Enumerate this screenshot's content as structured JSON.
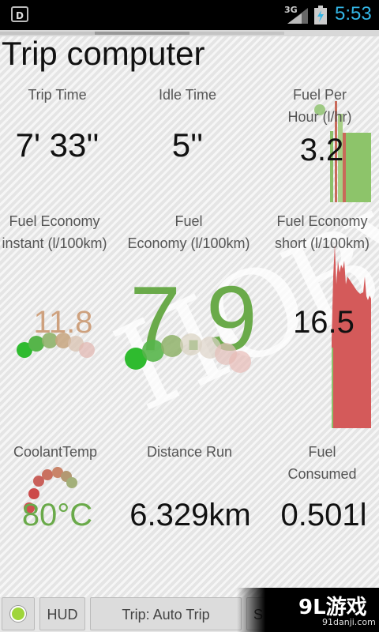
{
  "status_bar": {
    "network": "3G",
    "time": "5:53"
  },
  "title": "Trip computer",
  "gauges": {
    "trip_time": {
      "label": "Trip Time",
      "value": "7' 33''"
    },
    "idle_time": {
      "label": "Idle Time",
      "value": "5''"
    },
    "fuel_per_hour": {
      "label_line1": "Fuel Per",
      "label_line2": "Hour (l/hr)",
      "value": "3.2"
    },
    "fuel_economy_instant": {
      "label_line1": "Fuel Economy",
      "label_line2": "instant (l/100km)",
      "value": "11.8"
    },
    "fuel_economy": {
      "label_line1": "Fuel",
      "label_line2": "Economy (l/100km)",
      "value": "7.9"
    },
    "fuel_economy_short": {
      "label_line1": "Fuel Economy",
      "label_line2": "short (l/100km)",
      "value": "16.5"
    },
    "coolant_temp": {
      "label": "CoolantTemp",
      "value": "80°C"
    },
    "distance_run": {
      "label": "Distance Run",
      "value": "6.329km"
    },
    "fuel_consumed": {
      "label_line1": "Fuel",
      "label_line2": "Consumed",
      "value": "0.501l"
    }
  },
  "watermark": "HOBY",
  "bottom_bar": {
    "hud_label": "HUD",
    "trip_label": "Trip: Auto Trip",
    "partial_label": "S"
  },
  "branding": {
    "logo": "9L游戏",
    "url": "91danji.com"
  },
  "colors": {
    "accent_green": "#6aaa4a",
    "accent_tan": "#c9946b",
    "bar_red": "#d45a5a",
    "status_blue": "#33b5e5"
  }
}
